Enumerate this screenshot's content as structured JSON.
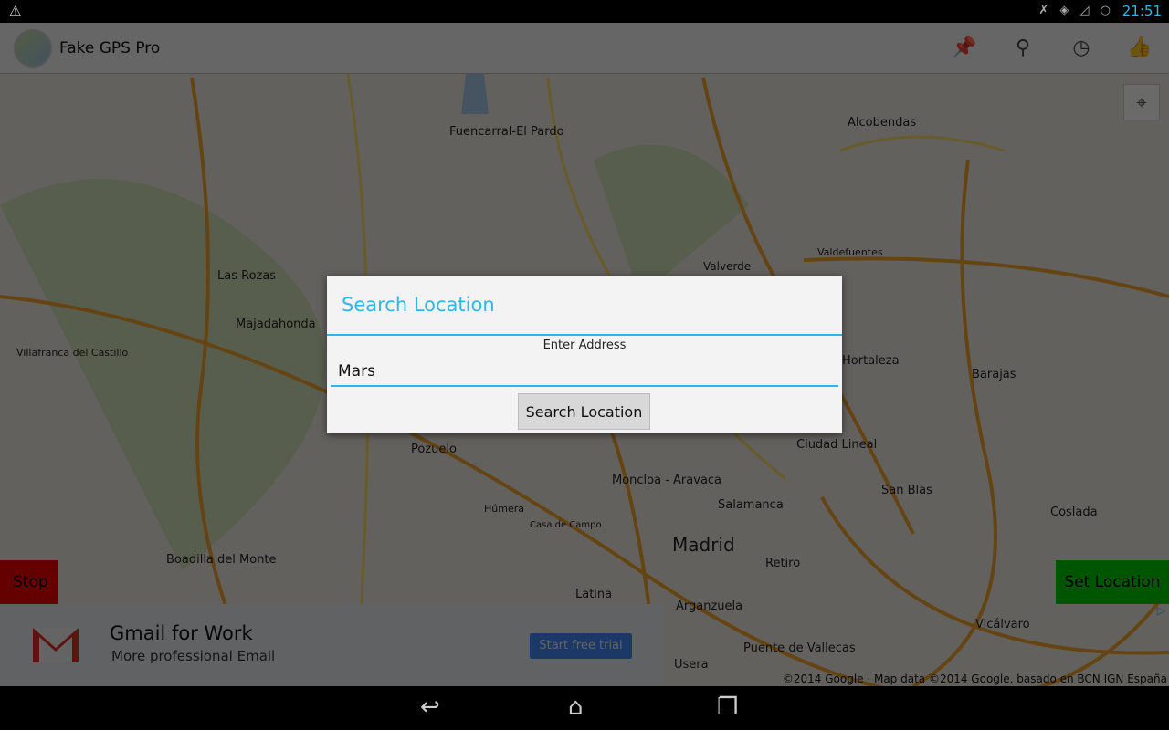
{
  "status_bar": {
    "time": "21:51",
    "warning_icon": "warning-icon",
    "icons": [
      "bluetooth-off-icon",
      "wifi-icon",
      "signal-icon",
      "sync-icon"
    ]
  },
  "action_bar": {
    "title": "Fake GPS Pro",
    "actions": [
      {
        "name": "pin-icon",
        "glyph": "📌"
      },
      {
        "name": "search-icon",
        "glyph": "⚲"
      },
      {
        "name": "history-icon",
        "glyph": "◷"
      },
      {
        "name": "thumbs-up-icon",
        "glyph": "👍"
      }
    ]
  },
  "map": {
    "labels": [
      "Fuencarral-El Pardo",
      "Alcobendas",
      "Las Rozas",
      "Majadahonda",
      "Villafranca del Castillo",
      "Pozuelo",
      "Moncloa - Aravaca",
      "Salamanca",
      "Ciudad Lineal",
      "San Blas",
      "Barajas",
      "Hortaleza",
      "Coslada",
      "Madrid",
      "Retiro",
      "Latina",
      "Arganzuela",
      "Boadilla del Monte",
      "Puente de Vallecas",
      "Vicálvaro",
      "Usera",
      "Valdefuentes",
      "Valverde",
      "Húmera",
      "Casa de Campo"
    ],
    "copyright": "©2014 Google · Map data ©2014 Google, basado en BCN IGN España"
  },
  "buttons": {
    "stop": "Stop",
    "set_location": "Set Location"
  },
  "ad": {
    "title": "Gmail for Work",
    "subtitle": "More professional Email",
    "cta": "Start free trial"
  },
  "dialog": {
    "title": "Search Location",
    "field_label": "Enter Address",
    "field_value": "Mars",
    "button": "Search Location"
  },
  "colors": {
    "accent": "#33b5e5",
    "stop": "#ee0000",
    "set_location": "#00cc00"
  }
}
